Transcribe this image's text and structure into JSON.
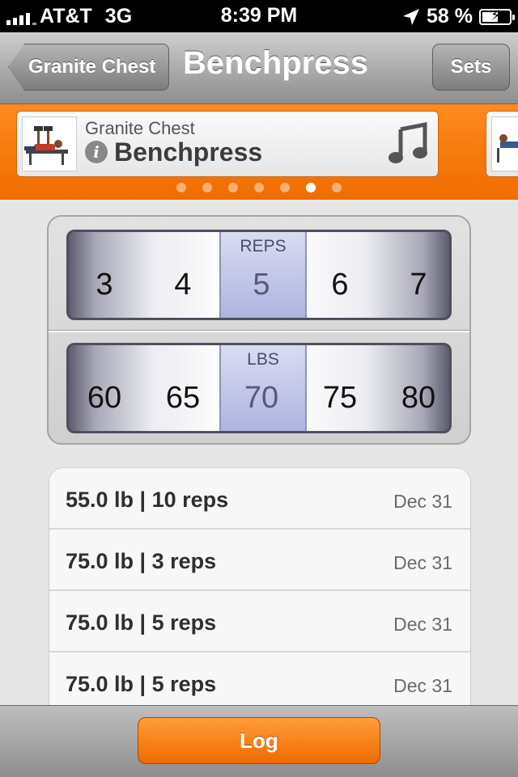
{
  "status_bar": {
    "carrier": "AT&T",
    "network": "3G",
    "time": "8:39 PM",
    "battery_percent": "58 %",
    "battery_level": 0.58
  },
  "nav": {
    "back_label": "Granite Chest",
    "title": "Benchpress",
    "sets_label": "Sets"
  },
  "exercise_card": {
    "group": "Granite Chest",
    "name": "Benchpress"
  },
  "page_dots": {
    "count": 7,
    "active_index": 5
  },
  "reps_picker": {
    "label": "REPS",
    "values": [
      "3",
      "4",
      "5",
      "6",
      "7"
    ],
    "selected": "5"
  },
  "lbs_picker": {
    "label": "LBS",
    "values": [
      "60",
      "65",
      "70",
      "75",
      "80"
    ],
    "selected": "70"
  },
  "history": [
    {
      "entry": "55.0 lb | 10 reps",
      "date": "Dec 31"
    },
    {
      "entry": "75.0 lb | 3 reps",
      "date": "Dec 31"
    },
    {
      "entry": "75.0 lb | 5 reps",
      "date": "Dec 31"
    },
    {
      "entry": "75.0 lb | 5 reps",
      "date": "Dec 31"
    }
  ],
  "log_button_label": "Log",
  "colors": {
    "accent_orange": "#f47a0f",
    "nav_gray": "#a9a9a9",
    "selection_blue": "#7f86c8"
  }
}
